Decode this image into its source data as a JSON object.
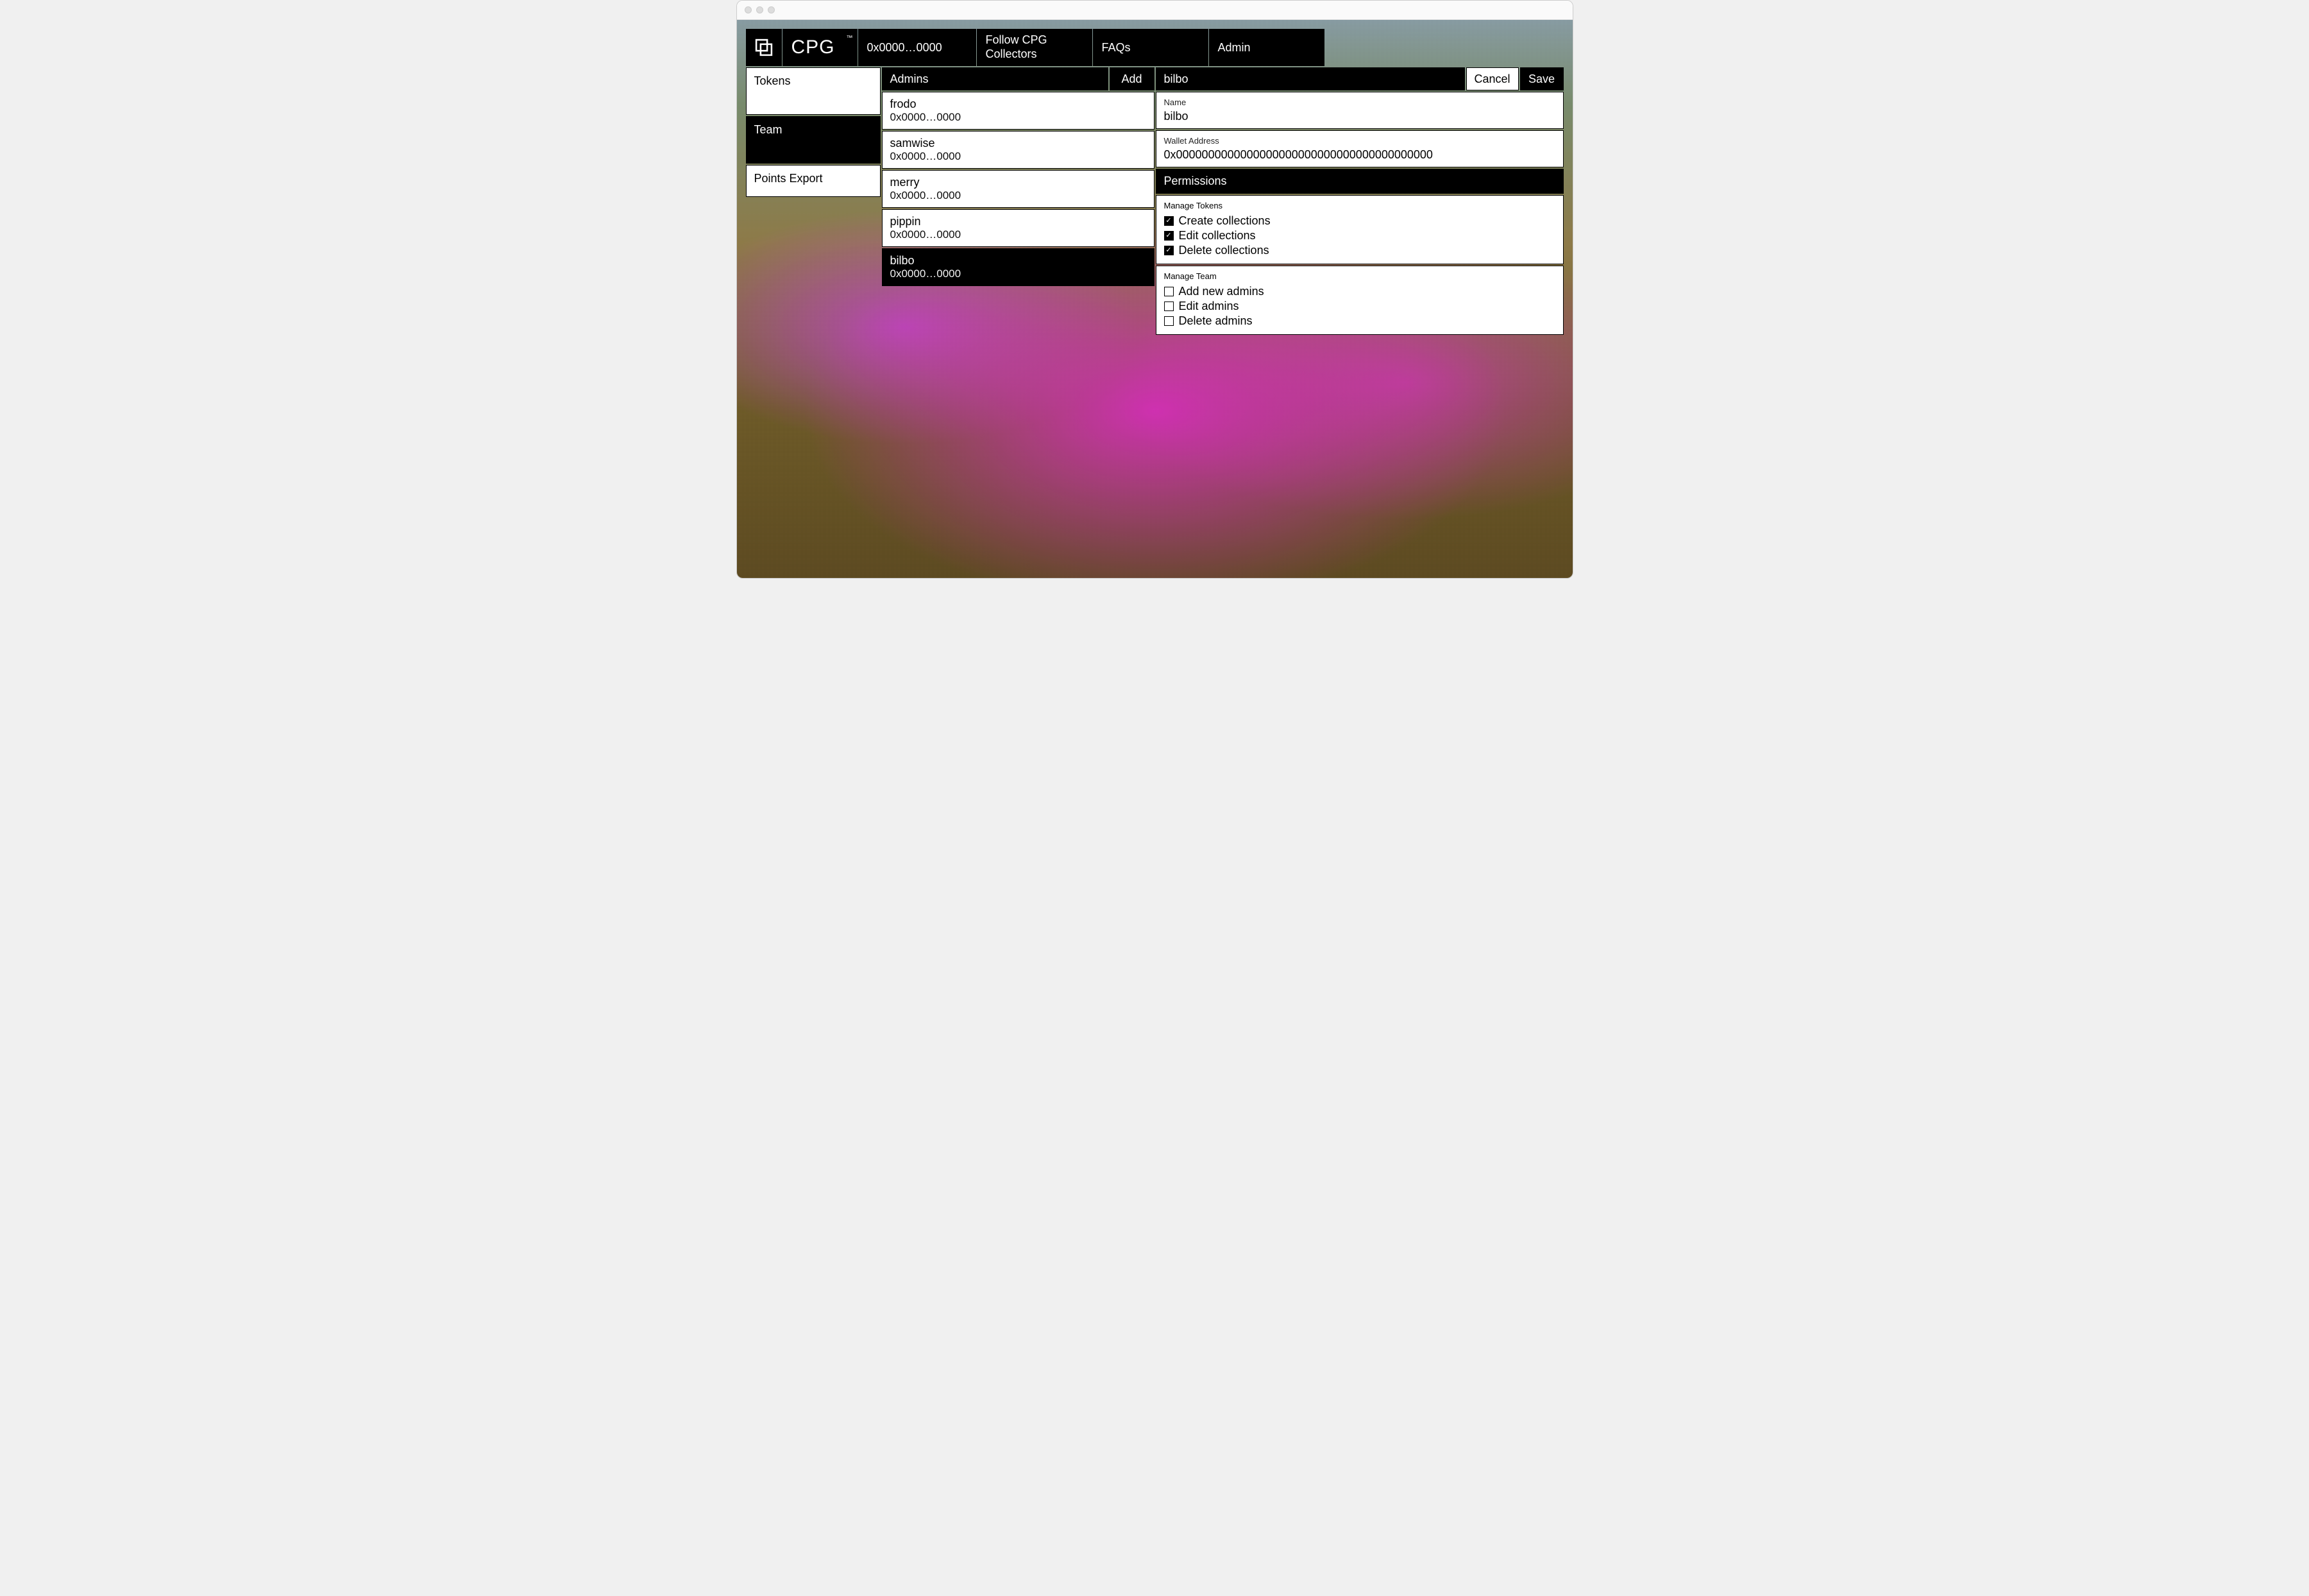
{
  "nav": {
    "brand": "CPG",
    "tm": "™",
    "wallet_short": "0x0000…0000",
    "follow_line1": "Follow CPG",
    "follow_line2": "Collectors",
    "faqs": "FAQs",
    "admin": "Admin"
  },
  "sidebar": {
    "items": [
      {
        "label": "Tokens",
        "active": true
      },
      {
        "label": "Team",
        "active": false
      },
      {
        "label": "Points Export",
        "active": true
      }
    ]
  },
  "admins": {
    "header": "Admins",
    "add_label": "Add",
    "list": [
      {
        "name": "frodo",
        "addr": "0x0000…0000",
        "selected": false
      },
      {
        "name": "samwise",
        "addr": "0x0000…0000",
        "selected": false
      },
      {
        "name": "merry",
        "addr": "0x0000…0000",
        "selected": false
      },
      {
        "name": "pippin",
        "addr": "0x0000…0000",
        "selected": false
      },
      {
        "name": "bilbo",
        "addr": "0x0000…0000",
        "selected": true
      }
    ]
  },
  "detail": {
    "title": "bilbo",
    "cancel_label": "Cancel",
    "save_label": "Save",
    "name_label": "Name",
    "name_value": "bilbo",
    "wallet_label": "Wallet Address",
    "wallet_value": "0x0000000000000000000000000000000000000000",
    "permissions_header": "Permissions",
    "groups": [
      {
        "title": "Manage Tokens",
        "items": [
          {
            "label": "Create collections",
            "checked": true
          },
          {
            "label": "Edit collections",
            "checked": true
          },
          {
            "label": "Delete collections",
            "checked": true
          }
        ]
      },
      {
        "title": "Manage Team",
        "items": [
          {
            "label": "Add new admins",
            "checked": false
          },
          {
            "label": "Edit admins",
            "checked": false
          },
          {
            "label": "Delete admins",
            "checked": false
          }
        ]
      }
    ]
  }
}
